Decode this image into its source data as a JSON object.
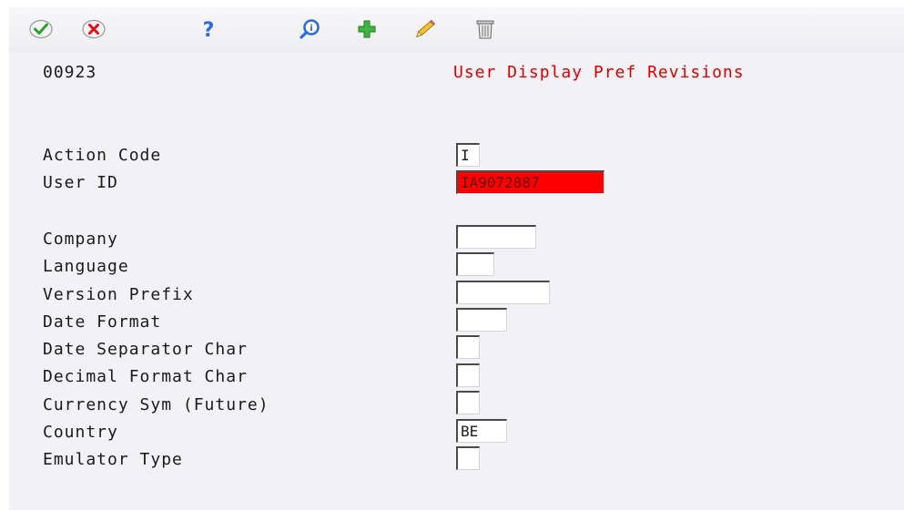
{
  "toolbar": {
    "icons": [
      "ok-checkmark-icon",
      "cancel-x-icon",
      "help-question-icon",
      "inquire-magnifier-icon",
      "add-plus-icon",
      "change-pencil-icon",
      "delete-trash-icon"
    ]
  },
  "header": {
    "form_code": "00923",
    "title": "User Display Pref Revisions"
  },
  "colors": {
    "title_red": "#e00000",
    "error_field": "#ff0000",
    "panel_bg": "#f2f2f6"
  },
  "fields": {
    "action_code": {
      "label": "Action Code",
      "value": "I"
    },
    "user_id": {
      "label": "User ID",
      "value": "IA9072887",
      "state": "error"
    },
    "company": {
      "label": "Company",
      "value": ""
    },
    "language": {
      "label": "Language",
      "value": ""
    },
    "version_prefix": {
      "label": "Version Prefix",
      "value": ""
    },
    "date_format": {
      "label": "Date Format",
      "value": ""
    },
    "date_separator": {
      "label": "Date Separator Char",
      "value": ""
    },
    "decimal_format": {
      "label": "Decimal Format Char",
      "value": ""
    },
    "currency_sym": {
      "label": "Currency Sym (Future)",
      "value": ""
    },
    "country": {
      "label": "Country",
      "value": "BE"
    },
    "emulator_type": {
      "label": "Emulator Type",
      "value": ""
    }
  }
}
